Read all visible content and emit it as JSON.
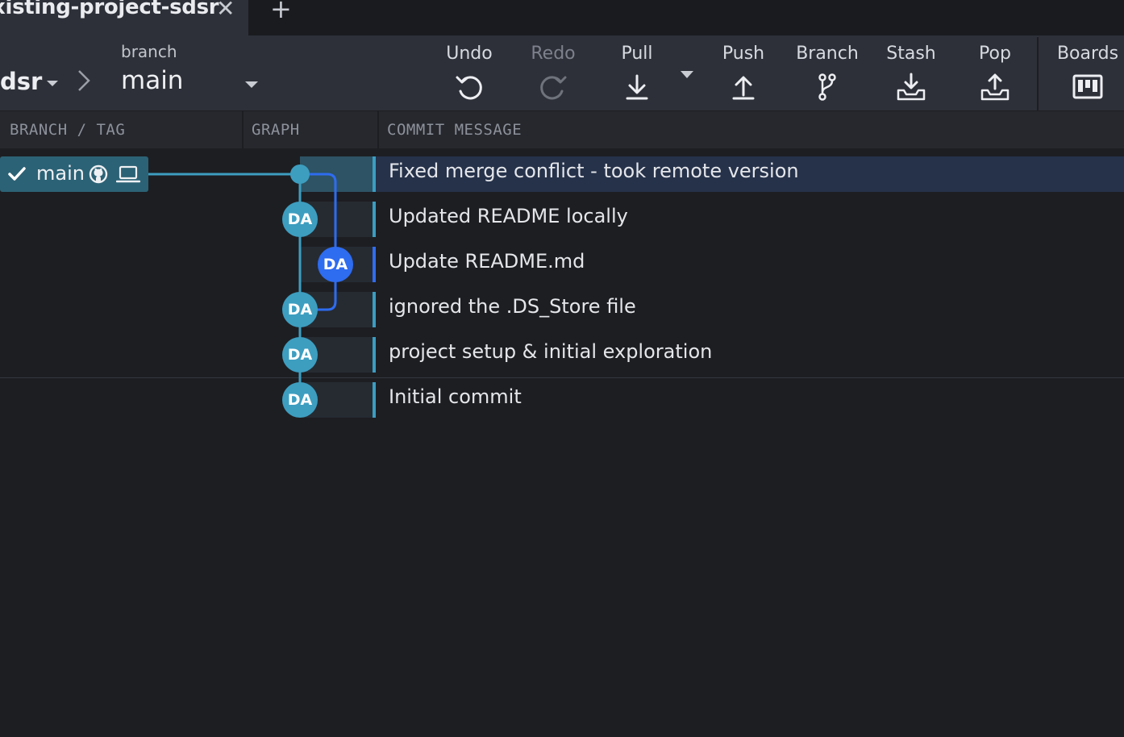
{
  "tab": {
    "title": "xisting-project-sdsr",
    "close_glyph": "✕",
    "add_glyph": "+"
  },
  "toolbar": {
    "repo": "dsr",
    "branch_label": "branch",
    "branch_name": "main",
    "buttons": [
      {
        "label": "Undo",
        "icon": "undo-icon",
        "enabled": true
      },
      {
        "label": "Redo",
        "icon": "redo-icon",
        "enabled": false
      },
      {
        "label": "Pull",
        "icon": "pull-icon",
        "enabled": true
      },
      {
        "label": "Push",
        "icon": "push-icon",
        "enabled": true
      },
      {
        "label": "Branch",
        "icon": "branch-icon",
        "enabled": true
      },
      {
        "label": "Stash",
        "icon": "stash-icon",
        "enabled": true
      },
      {
        "label": "Pop",
        "icon": "pop-icon",
        "enabled": true
      },
      {
        "label": "Boards",
        "icon": "boards-icon",
        "enabled": true
      }
    ]
  },
  "columns": {
    "branch_tag": "BRANCH / TAG",
    "graph": "GRAPH",
    "commit_message": "COMMIT MESSAGE"
  },
  "branch_pill": {
    "name": "main",
    "icons": [
      "check-icon",
      "github-icon",
      "laptop-icon"
    ]
  },
  "commits": [
    {
      "message": "Fixed merge conflict - took remote version",
      "author": "",
      "lane": 0,
      "selected": true
    },
    {
      "message": "Updated README locally",
      "author": "DA",
      "lane": 0
    },
    {
      "message": "Update README.md",
      "author": "DA",
      "lane": 1
    },
    {
      "message": "ignored the .DS_Store file",
      "author": "DA",
      "lane": 0
    },
    {
      "message": "project setup & initial exploration",
      "author": "DA",
      "lane": 0
    },
    {
      "message": "Initial commit",
      "author": "DA",
      "lane": 0
    }
  ],
  "colors": {
    "lane0": "#3d9ec0",
    "lane1": "#2e6cf0",
    "selected_row": "#26324a",
    "branch_pill": "#2c6275"
  }
}
